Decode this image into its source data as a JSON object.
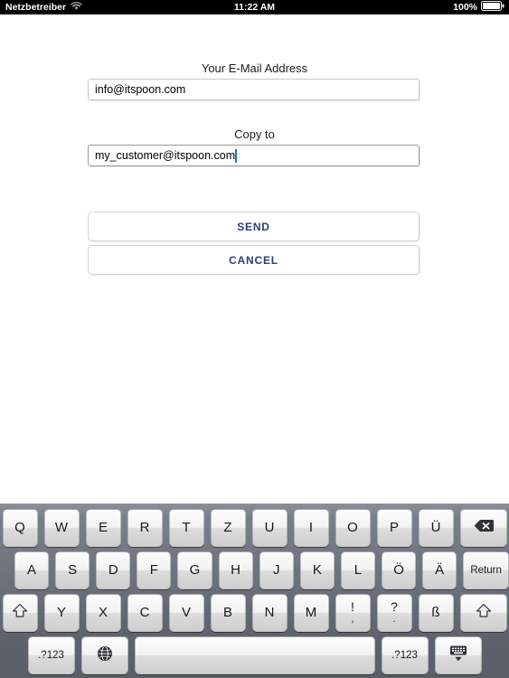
{
  "status_bar": {
    "carrier": "Netzbetreiber",
    "wifi_icon": "wifi-icon",
    "time": "11:22 AM",
    "battery_percent": "100%",
    "battery_icon": "battery-full-icon"
  },
  "form": {
    "email_label": "Your E-Mail Address",
    "email_value": "info@itspoon.com",
    "email_placeholder": "Your E-Mail Address",
    "copy_label": "Copy to",
    "copy_value": "my_customer@itspoon.com",
    "copy_placeholder": "Copy to",
    "send_label": "SEND",
    "cancel_label": "CANCEL",
    "accent_color": "#2b3f7a",
    "caret_color": "#1a6fe0"
  },
  "keyboard": {
    "layout": "QWERTZ-German",
    "background_color": "#60646f",
    "key_color": "#e8e8e8",
    "row1": [
      {
        "label": "Q",
        "name": "key-q"
      },
      {
        "label": "W",
        "name": "key-w"
      },
      {
        "label": "E",
        "name": "key-e"
      },
      {
        "label": "R",
        "name": "key-r"
      },
      {
        "label": "T",
        "name": "key-t"
      },
      {
        "label": "Z",
        "name": "key-z"
      },
      {
        "label": "U",
        "name": "key-u"
      },
      {
        "label": "I",
        "name": "key-i"
      },
      {
        "label": "O",
        "name": "key-o"
      },
      {
        "label": "P",
        "name": "key-p"
      },
      {
        "label": "Ü",
        "name": "key-u-umlaut"
      }
    ],
    "backspace_label": "backspace-icon",
    "row2": [
      {
        "label": "A",
        "name": "key-a"
      },
      {
        "label": "S",
        "name": "key-s"
      },
      {
        "label": "D",
        "name": "key-d"
      },
      {
        "label": "F",
        "name": "key-f"
      },
      {
        "label": "G",
        "name": "key-g"
      },
      {
        "label": "H",
        "name": "key-h"
      },
      {
        "label": "J",
        "name": "key-j"
      },
      {
        "label": "K",
        "name": "key-k"
      },
      {
        "label": "L",
        "name": "key-l"
      },
      {
        "label": "Ö",
        "name": "key-o-umlaut"
      },
      {
        "label": "Ä",
        "name": "key-a-umlaut"
      }
    ],
    "return_label": "Return",
    "row3": [
      {
        "label": "Y",
        "name": "key-y"
      },
      {
        "label": "X",
        "name": "key-x"
      },
      {
        "label": "C",
        "name": "key-c"
      },
      {
        "label": "V",
        "name": "key-v"
      },
      {
        "label": "B",
        "name": "key-b"
      },
      {
        "label": "N",
        "name": "key-n"
      },
      {
        "label": "M",
        "name": "key-m"
      }
    ],
    "punct1_top": "!",
    "punct1_bottom": ",",
    "punct2_top": "?",
    "punct2_bottom": ".",
    "eszett_label": "ß",
    "shift_label": "shift-icon",
    "numeric_label": ".?123",
    "globe_label": "globe-icon",
    "space_label": "",
    "hide_keyboard_label": "hide-keyboard-icon"
  }
}
